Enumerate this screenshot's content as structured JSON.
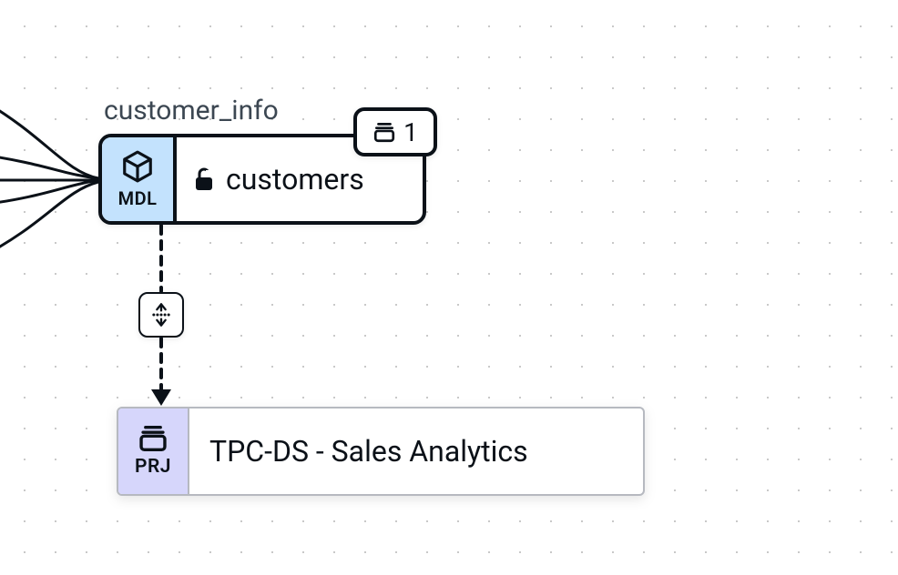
{
  "model_node": {
    "group_label": "customer_info",
    "type_label": "MDL",
    "entity_name": "customers",
    "badge_count": "1"
  },
  "project_node": {
    "type_label": "PRJ",
    "title": "TPC-DS - Sales Analytics"
  }
}
